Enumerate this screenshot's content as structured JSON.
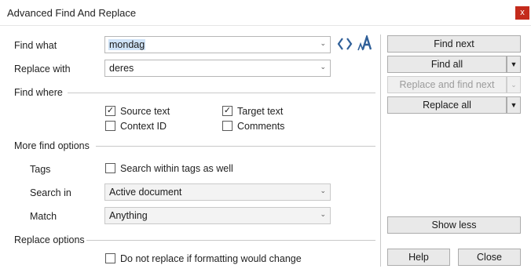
{
  "window": {
    "title": "Advanced Find And Replace",
    "close": "x"
  },
  "find_what": {
    "label": "Find what",
    "value": "mondag"
  },
  "replace_with": {
    "label": "Replace with",
    "value": "deres"
  },
  "find_where": {
    "heading": "Find where",
    "source_text": {
      "label": "Source text",
      "checked": true
    },
    "target_text": {
      "label": "Target text",
      "checked": true
    },
    "context_id": {
      "label": "Context ID",
      "checked": false
    },
    "comments": {
      "label": "Comments",
      "checked": false
    }
  },
  "more_options": {
    "heading": "More find options",
    "tags_label": "Tags",
    "tags_option": "Search within tags as well",
    "search_in_label": "Search in",
    "search_in_value": "Active document",
    "match_label": "Match",
    "match_value": "Anything"
  },
  "replace_options": {
    "heading": "Replace options",
    "no_format_change": "Do not replace if formatting would change"
  },
  "buttons": {
    "find_next": "Find next",
    "find_all": "Find all",
    "replace_and_find_next": "Replace and find next",
    "replace_all": "Replace all",
    "show_less": "Show less",
    "help": "Help",
    "close": "Close"
  },
  "glyphs": {
    "check": "✓",
    "caret": "⌄",
    "arrow": "▼"
  },
  "icons": {
    "regex": "regex-brackets-icon",
    "font": "font-style-icon"
  },
  "colors": {
    "close_bg": "#c42b1c",
    "selection": "#cfe3f7",
    "icon_blue": "#2f5f98"
  }
}
